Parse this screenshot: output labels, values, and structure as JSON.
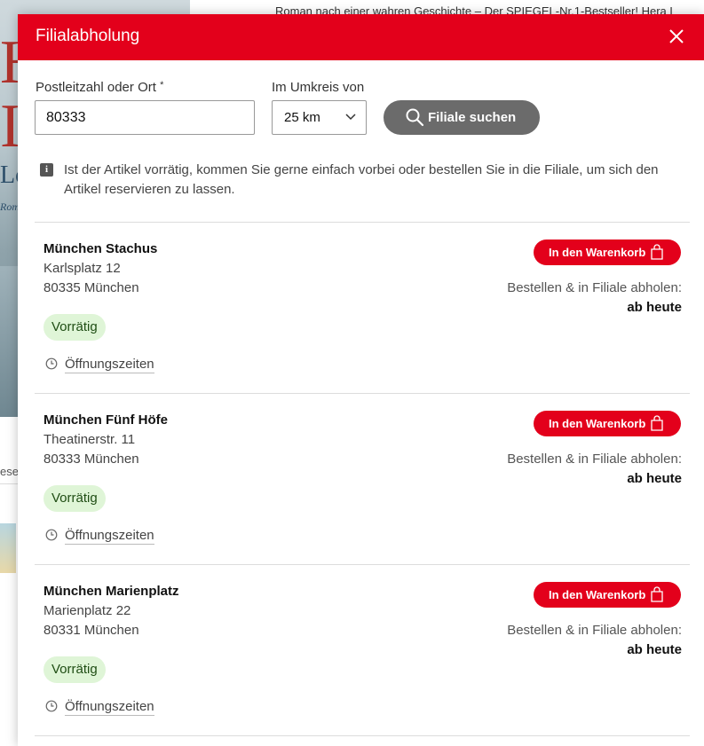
{
  "background": {
    "top_line": "Roman nach einer wahren Geschichte – Der SPIEGEL-Nr.1-Bestseller! Hera L",
    "cover_letters": "H\nI",
    "cover_sub": "Lo",
    "cover_sub2": "Roma",
    "side_text": "ese"
  },
  "modal": {
    "title": "Filialabholung",
    "close_icon": "close-icon"
  },
  "search": {
    "zip_label": "Postleitzahl oder Ort",
    "zip_required_mark": "*",
    "zip_value": "80333",
    "radius_label": "Im Umkreis von",
    "radius_value": "25 km",
    "button_label": "Filiale suchen"
  },
  "info": {
    "icon": "i",
    "text": "Ist der Artikel vorrätig, kommen Sie gerne einfach vorbei oder bestellen Sie in die Filiale, um sich den Artikel reservieren zu lassen."
  },
  "stores": [
    {
      "name": "München Stachus",
      "street": "Karlsplatz 12",
      "city": "80335 München",
      "stock": "Vorrätig",
      "hours_label": "Öffnungszeiten",
      "cart_label": "In den Warenkorb",
      "pickup_label": "Bestellen & in Filiale abholen:",
      "pickup_value": "ab heute"
    },
    {
      "name": "München Fünf Höfe",
      "street": "Theatinerstr. 11",
      "city": "80333 München",
      "stock": "Vorrätig",
      "hours_label": "Öffnungszeiten",
      "cart_label": "In den Warenkorb",
      "pickup_label": "Bestellen & in Filiale abholen:",
      "pickup_value": "ab heute"
    },
    {
      "name": "München Marienplatz",
      "street": "Marienplatz 22",
      "city": "80331 München",
      "stock": "Vorrätig",
      "hours_label": "Öffnungszeiten",
      "cart_label": "In den Warenkorb",
      "pickup_label": "Bestellen & in Filiale abholen:",
      "pickup_value": "ab heute"
    }
  ],
  "colors": {
    "brand_red": "#e3001b",
    "button_gray": "#6b6b6b",
    "stock_bg": "#dff5d7"
  }
}
